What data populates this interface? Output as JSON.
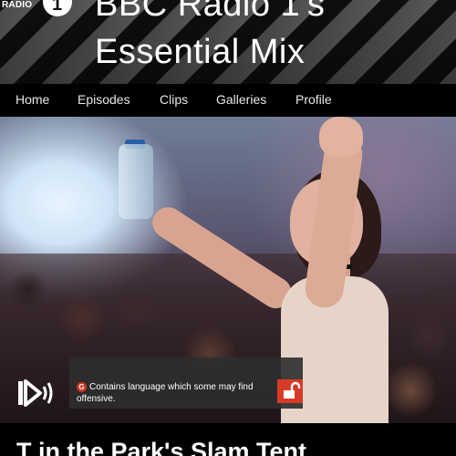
{
  "header": {
    "logo_text": "RADIO",
    "logo_number": "1",
    "title_line1": "BBC Radio 1's",
    "title_line2": "Essential Mix"
  },
  "nav": {
    "items": [
      {
        "label": "Home"
      },
      {
        "label": "Episodes"
      },
      {
        "label": "Clips"
      },
      {
        "label": "Galleries"
      },
      {
        "label": "Profile"
      }
    ]
  },
  "media": {
    "play_icon": "audio-described-icon",
    "guidance_badge": "G",
    "warning_text": "Contains language which some may find offensive.",
    "lock_icon": "padlock-unlocked-icon",
    "accent_color": "#d63b26"
  },
  "episode": {
    "title": "T in the Park's Slam Tent"
  }
}
